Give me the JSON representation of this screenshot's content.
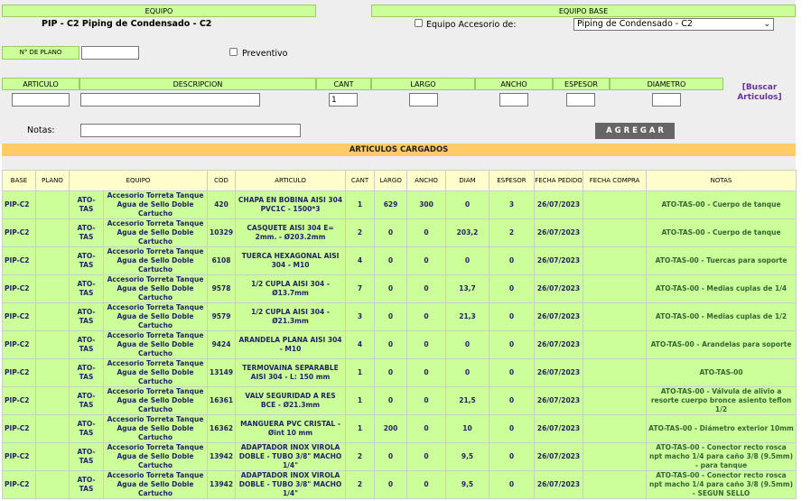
{
  "header": {
    "equipo_label": "EQUIPO",
    "equipo_value": "PIP - C2 Piping de Condensado - C2",
    "equipo_base_label": "EQUIPO BASE",
    "accesorio_label": "Equipo Accesorio de:",
    "accesorio_select": "Piping de Condensado - C2",
    "plano_label": "N° DE PLANO",
    "preventivo_label": "Preventivo"
  },
  "form": {
    "articulo": "ARTICULO",
    "descripcion": "DESCRIPCION",
    "cant": "CANT",
    "largo": "LARGO",
    "ancho": "ANCHO",
    "espesor": "ESPESOR",
    "diametro": "DIAMETRO",
    "cant_value": "1",
    "buscar_open": "[",
    "buscar_word1": "Buscar",
    "buscar_word2": "Articulos",
    "buscar_close": "]",
    "notas": "Notas:",
    "agregar": "A G R E G A R"
  },
  "loaded_title": "ARTICULOS CARGADOS",
  "table": {
    "headers": [
      "BASE",
      "PLANO",
      "EQUIPO",
      "COD",
      "ARTICULO",
      "CANT",
      "LARGO",
      "ANCHO",
      "DIAM",
      "ESPESOR",
      "FECHA PEDIDO",
      "FECHA COMPRA",
      "NOTAS"
    ],
    "rows": [
      [
        "PIP-C2",
        "",
        "ATO-TAS",
        "Accesorio Torreta Tanque Agua de Sello Doble Cartucho",
        "420",
        "CHAPA EN BOBINA AISI 304 PVC1C - 1500*3",
        "1",
        "629",
        "300",
        "0",
        "3",
        "26/07/2023",
        "",
        "ATO-TAS-00 - Cuerpo de tanque"
      ],
      [
        "PIP-C2",
        "",
        "ATO-TAS",
        "Accesorio Torreta Tanque Agua de Sello Doble Cartucho",
        "10329",
        "CASQUETE AISI 304 E= 2mm. - Ø203.2mm",
        "2",
        "0",
        "0",
        "203,2",
        "2",
        "26/07/2023",
        "",
        "ATO-TAS-00 - Cuerpo de tanque"
      ],
      [
        "PIP-C2",
        "",
        "ATO-TAS",
        "Accesorio Torreta Tanque Agua de Sello Doble Cartucho",
        "6108",
        "TUERCA HEXAGONAL AISI 304 - M10",
        "4",
        "0",
        "0",
        "0",
        "0",
        "26/07/2023",
        "",
        "ATO-TAS-00 - Tuercas para soporte"
      ],
      [
        "PIP-C2",
        "",
        "ATO-TAS",
        "Accesorio Torreta Tanque Agua de Sello Doble Cartucho",
        "9578",
        "1/2 CUPLA AISI 304 - Ø13.7mm",
        "7",
        "0",
        "0",
        "13,7",
        "0",
        "26/07/2023",
        "",
        "ATO-TAS-00 - Medias cuplas de 1/4"
      ],
      [
        "PIP-C2",
        "",
        "ATO-TAS",
        "Accesorio Torreta Tanque Agua de Sello Doble Cartucho",
        "9579",
        "1/2 CUPLA AISI 304 - Ø21.3mm",
        "3",
        "0",
        "0",
        "21,3",
        "0",
        "26/07/2023",
        "",
        "ATO-TAS-00 - Medias cuplas de 1/2"
      ],
      [
        "PIP-C2",
        "",
        "ATO-TAS",
        "Accesorio Torreta Tanque Agua de Sello Doble Cartucho",
        "9424",
        "ARANDELA PLANA AISI 304 - M10",
        "4",
        "0",
        "0",
        "0",
        "0",
        "26/07/2023",
        "",
        "ATO-TAS-00 - Arandelas para soporte"
      ],
      [
        "PIP-C2",
        "",
        "ATO-TAS",
        "Accesorio Torreta Tanque Agua de Sello Doble Cartucho",
        "13149",
        "TERMOVAINA SEPARABLE AISI 304 - L: 150 mm",
        "1",
        "0",
        "0",
        "0",
        "0",
        "26/07/2023",
        "",
        "ATO-TAS-00"
      ],
      [
        "PIP-C2",
        "",
        "ATO-TAS",
        "Accesorio Torreta Tanque Agua de Sello Doble Cartucho",
        "16361",
        "VALV SEGURIDAD A RES BCE - Ø21.3mm",
        "1",
        "0",
        "0",
        "21,5",
        "0",
        "26/07/2023",
        "",
        "ATO-TAS-00 - Válvula de alivio a resorte cuerpo bronce asiento teflon 1/2"
      ],
      [
        "PIP-C2",
        "",
        "ATO-TAS",
        "Accesorio Torreta Tanque Agua de Sello Doble Cartucho",
        "16362",
        "MANGUERA PVC CRISTAL - Øint 10 mm",
        "1",
        "200",
        "0",
        "10",
        "0",
        "26/07/2023",
        "",
        "ATO-TAS-00 - Diámetro exterior 10mm"
      ],
      [
        "PIP-C2",
        "",
        "ATO-TAS",
        "Accesorio Torreta Tanque Agua de Sello Doble Cartucho",
        "13942",
        "ADAPTADOR INOX VIROLA DOBLE - TUBO 3/8\" MACHO 1/4\"",
        "2",
        "0",
        "0",
        "9,5",
        "0",
        "26/07/2023",
        "",
        "ATO-TAS-00 - Conector recto rosca npt macho 1/4 para caño 3/8 (9.5mm) - para tanque"
      ],
      [
        "PIP-C2",
        "",
        "ATO-TAS",
        "Accesorio Torreta Tanque Agua de Sello Doble Cartucho",
        "13942",
        "ADAPTADOR INOX VIROLA DOBLE - TUBO 3/8\" MACHO 1/4\"",
        "2",
        "0",
        "0",
        "9,5",
        "0",
        "26/07/2023",
        "",
        "ATO-TAS-00 - Conector recto rosca npt macho 1/4 para caño 3/8 (9.5mm) - SEGUN SELLO"
      ]
    ]
  }
}
